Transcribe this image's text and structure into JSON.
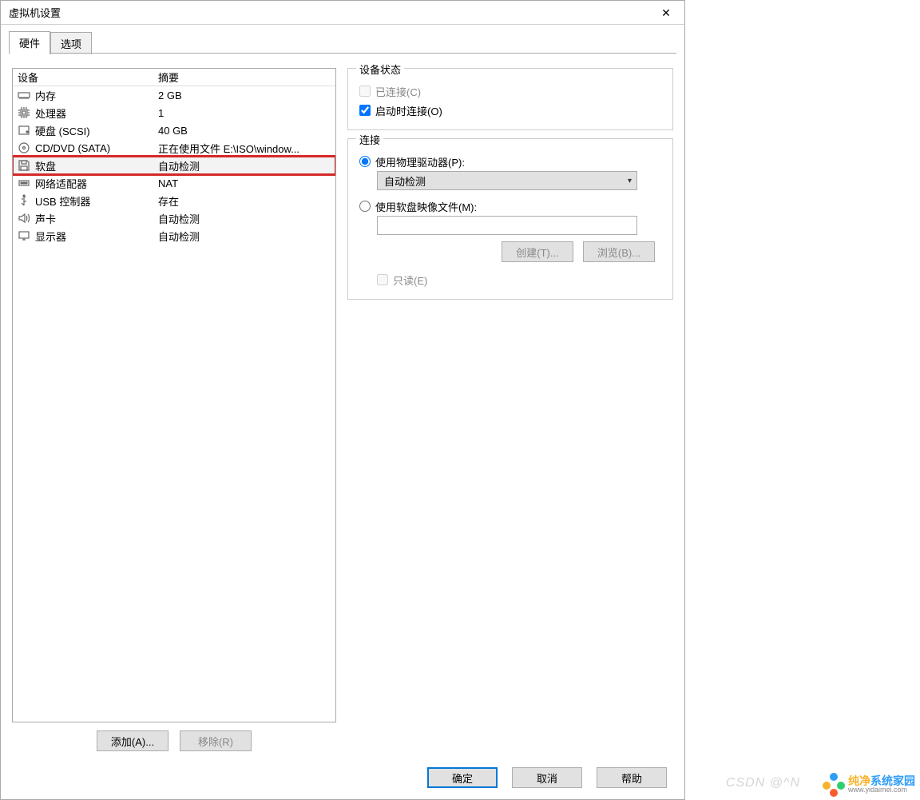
{
  "window": {
    "title": "虚拟机设置"
  },
  "tabs": {
    "hardware": "硬件",
    "options": "选项"
  },
  "hw_table": {
    "header_device": "设备",
    "header_summary": "摘要",
    "rows": [
      {
        "icon": "memory",
        "device": "内存",
        "summary": "2 GB"
      },
      {
        "icon": "cpu",
        "device": "处理器",
        "summary": "1"
      },
      {
        "icon": "hdd",
        "device": "硬盘 (SCSI)",
        "summary": "40 GB"
      },
      {
        "icon": "disc",
        "device": "CD/DVD (SATA)",
        "summary": "正在使用文件 E:\\ISO\\window..."
      },
      {
        "icon": "floppy",
        "device": "软盘",
        "summary": "自动检测"
      },
      {
        "icon": "network",
        "device": "网络适配器",
        "summary": "NAT"
      },
      {
        "icon": "usb",
        "device": "USB 控制器",
        "summary": "存在"
      },
      {
        "icon": "sound",
        "device": "声卡",
        "summary": "自动检测"
      },
      {
        "icon": "display",
        "device": "显示器",
        "summary": "自动检测"
      }
    ],
    "selected_index": 4
  },
  "left_buttons": {
    "add": "添加(A)...",
    "remove": "移除(R)"
  },
  "status_group": {
    "legend": "设备状态",
    "connected": "已连接(C)",
    "connect_at_power_on": "启动时连接(O)"
  },
  "connection_group": {
    "legend": "连接",
    "use_physical": "使用物理驱动器(P):",
    "physical_value": "自动检测",
    "use_image": "使用软盘映像文件(M):",
    "image_path": "",
    "create": "创建(T)...",
    "browse": "浏览(B)...",
    "read_only": "只读(E)"
  },
  "footer": {
    "ok": "确定",
    "cancel": "取消",
    "help": "帮助"
  },
  "watermark": {
    "csdn": "CSDN @^N",
    "brand_a": "纯净",
    "brand_b": "系统家园",
    "url": "www.yidaimei.com"
  }
}
